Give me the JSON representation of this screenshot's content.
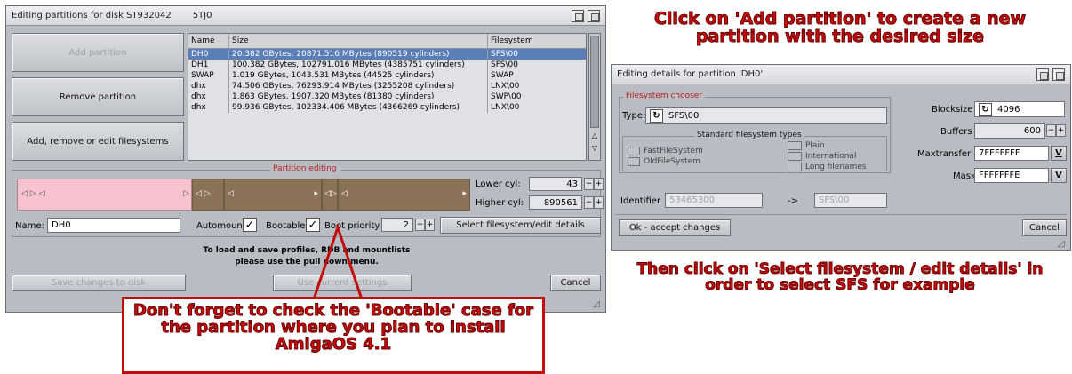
{
  "main_window": {
    "title": "Editing partitions for disk ST932042",
    "title_suffix": "5TJ0",
    "buttons": {
      "add_partition": "Add partition",
      "remove_partition": "Remove partition",
      "filesystems": "Add, remove or edit filesystems"
    },
    "table": {
      "headers": [
        "Name",
        "Size",
        "Filesystem"
      ],
      "rows": [
        {
          "name": "DH0",
          "size": "20.382 GBytes, 20871.516 MBytes (890519 cylinders)",
          "fs": "SFS\\00"
        },
        {
          "name": "DH1",
          "size": "100.382 GBytes, 102791.016 MBytes (4385751 cylinders)",
          "fs": "SFS\\00"
        },
        {
          "name": "SWAP",
          "size": "1.019 GBytes, 1043.531 MBytes (44525 cylinders)",
          "fs": "SWAP"
        },
        {
          "name": "dhx",
          "size": "74.506 GBytes, 76293.914 MBytes (3255208 cylinders)",
          "fs": "LNX\\00"
        },
        {
          "name": "dhx",
          "size": "1.863 GBytes, 1907.320 MBytes (81380 cylinders)",
          "fs": "SWP\\00"
        },
        {
          "name": "dhx",
          "size": "99.936 GBytes, 102334.406 MBytes (4366269 cylinders)",
          "fs": "LNX\\00"
        }
      ]
    },
    "partition_editing": {
      "title": "Partition editing",
      "lower_cyl_label": "Lower cyl:",
      "lower_cyl_value": "43",
      "higher_cyl_label": "Higher cyl:",
      "higher_cyl_value": "890561",
      "name_label": "Name:",
      "name_value": "DH0",
      "automount_label": "Automount",
      "bootable_label": "Bootable",
      "boot_priority_label": "Boot priority",
      "boot_priority_value": "2",
      "select_fs_button": "Select filesystem/edit details"
    },
    "info_line1": "To load and save profiles, RDB and mountlists",
    "info_line2": "please use the pull down menu.",
    "bottom_buttons": {
      "left": "Save changes to disk",
      "middle": "Use current settings",
      "cancel": "Cancel"
    }
  },
  "details_window": {
    "title": "Editing details for partition 'DH0'",
    "filesystem_chooser": "Filesystem chooser",
    "type_label": "Type:",
    "type_value": "SFS\\00",
    "standard_fs_types": "Standard filesystem types",
    "fs_options": {
      "fastfilesystem": "FastFileSystem",
      "oldfilesystem": "OldFileSystem",
      "plain": "Plain",
      "international": "International",
      "long_filenames": "Long filenames"
    },
    "identifier_label": "Identifier",
    "identifier_value": "53465300",
    "arrow": "->",
    "identifier_result": "SFS\\00",
    "blocksize_label": "Blocksize",
    "blocksize_value": "4096",
    "buffers_label": "Buffers",
    "buffers_value": "600",
    "maxtransfer_label": "Maxtransfer",
    "maxtransfer_value": "7FFFFFFF",
    "mask_label": "Mask",
    "mask_value": "FFFFFFFE",
    "ok_button": "Ok - accept changes",
    "cancel_button": "Cancel"
  },
  "annotations": {
    "top_right": "Click on 'Add partition' to create a new partition with the desired size",
    "bottom_right": "Then click on 'Select filesystem / edit details' in order to select SFS for example",
    "bottom_center": "Don't forget to check the 'Bootable' case for the partition where you plan to install AmigaOS 4.1"
  },
  "colors": {
    "annotation_red": "#c40d0d",
    "selection_blue": "#5a7fb8",
    "partition_pink": "#f6c3cf",
    "partition_brown": "#8a7257"
  }
}
